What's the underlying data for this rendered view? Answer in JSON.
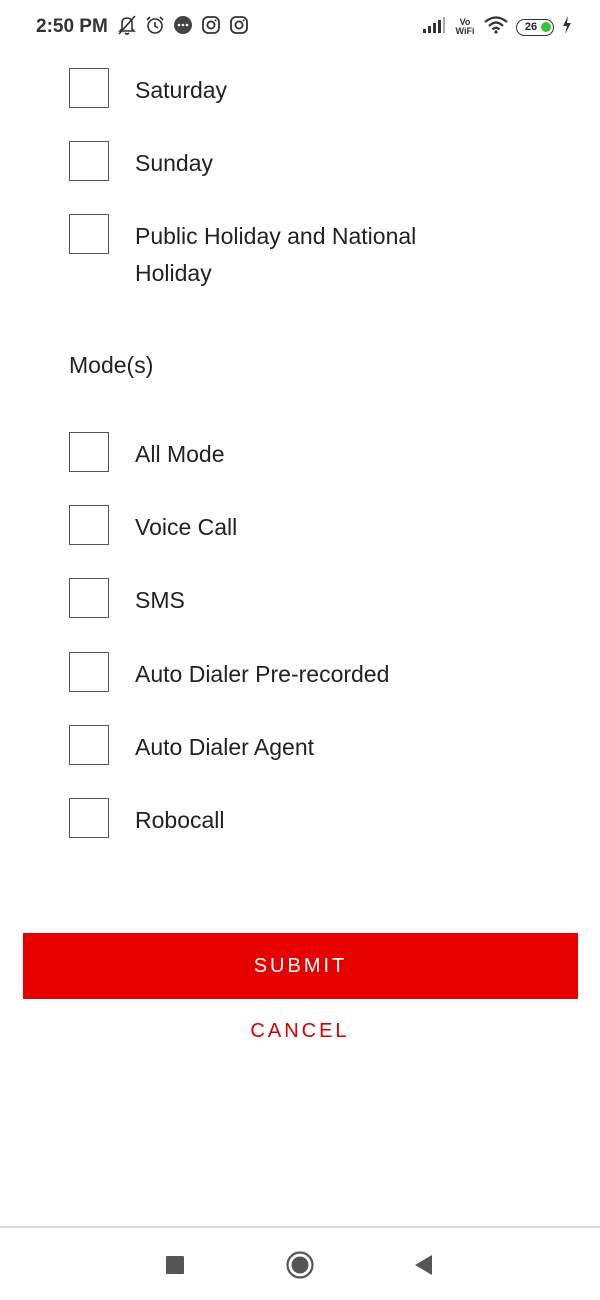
{
  "status_bar": {
    "time": "2:50 PM",
    "left_icons": [
      "muted-bell-icon",
      "alarm-clock-icon",
      "chat-bubble-icon",
      "instagram-icon",
      "instagram-icon"
    ],
    "network_label_top": "Vo",
    "network_label_bottom": "WiFi",
    "battery_level": "26"
  },
  "days": [
    {
      "label": "Saturday",
      "checked": false
    },
    {
      "label": "Sunday",
      "checked": false
    },
    {
      "label": "Public Holiday and National Holiday",
      "checked": false
    }
  ],
  "modes": {
    "title": "Mode(s)",
    "items": [
      {
        "label": "All Mode",
        "checked": false
      },
      {
        "label": "Voice Call",
        "checked": false
      },
      {
        "label": "SMS",
        "checked": false
      },
      {
        "label": "Auto Dialer Pre-recorded",
        "checked": false
      },
      {
        "label": "Auto Dialer Agent",
        "checked": false
      },
      {
        "label": "Robocall",
        "checked": false
      }
    ]
  },
  "actions": {
    "submit_label": "SUBMIT",
    "cancel_label": "CANCEL"
  },
  "colors": {
    "accent": "#e60000",
    "cancel_text": "#d50000",
    "battery_fill": "#35c335"
  },
  "nav": {
    "icons": [
      "recent-apps-icon",
      "home-icon",
      "back-icon"
    ]
  }
}
